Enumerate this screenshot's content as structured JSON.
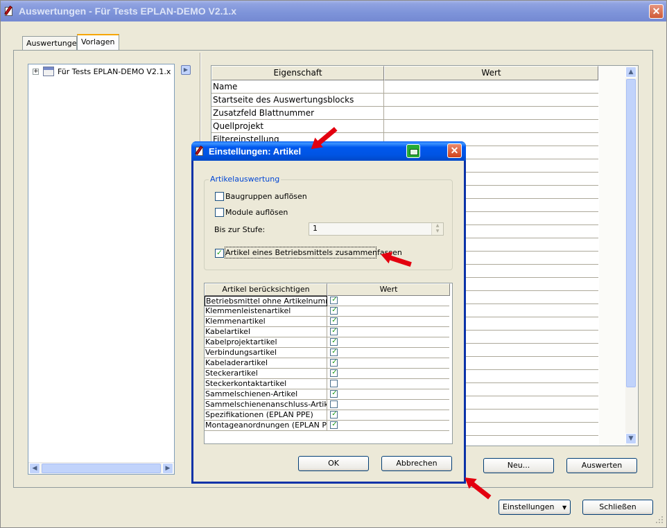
{
  "main_window": {
    "title": "Auswertungen - Für Tests EPLAN-DEMO V2.1.x",
    "close_glyph": "✕",
    "tabs": [
      {
        "label": "Auswertungen",
        "active": false
      },
      {
        "label": "Vorlagen",
        "active": true
      }
    ],
    "tree": {
      "root_label": "Für Tests EPLAN-DEMO V2.1.x",
      "expander_glyph": "+"
    },
    "properties": {
      "header_property": "Eigenschaft",
      "header_value": "Wert",
      "rows": [
        "Name",
        "Startseite des Auswertungsblocks",
        "Zusatzfeld Blattnummer",
        "Quellprojekt",
        "Filtereinstellung"
      ]
    },
    "buttons": {
      "neu": "Neu...",
      "auswerten": "Auswerten",
      "einstellungen": "Einstellungen",
      "schliessen": "Schließen"
    }
  },
  "dialog": {
    "title": "Einstellungen: Artikel",
    "close_glyph": "✕",
    "group_title": "Artikelauswertung",
    "options": {
      "baugruppen": {
        "label": "Baugruppen auflösen",
        "checked": false
      },
      "module": {
        "label": "Module auflösen",
        "checked": false
      },
      "stufe_label": "Bis zur Stufe:",
      "stufe_value": "1",
      "zusammenfassen": {
        "label": "Artikel eines Betriebsmittels zusammenfassen",
        "checked": true
      }
    },
    "table": {
      "header_label": "Artikel berücksichtigen",
      "header_value": "Wert",
      "rows": [
        {
          "label": "Betriebsmittel ohne Artikelnummer",
          "checked": true
        },
        {
          "label": "Klemmenleistenartikel",
          "checked": true
        },
        {
          "label": "Klemmenartikel",
          "checked": true
        },
        {
          "label": "Kabelartikel",
          "checked": true
        },
        {
          "label": "Kabelprojektartikel",
          "checked": true
        },
        {
          "label": "Verbindungsartikel",
          "checked": true
        },
        {
          "label": "Kabeladerartikel",
          "checked": true
        },
        {
          "label": "Steckerartikel",
          "checked": true
        },
        {
          "label": "Steckerkontaktartikel",
          "checked": false
        },
        {
          "label": "Sammelschienen-Artikel",
          "checked": true
        },
        {
          "label": "Sammelschienenanschluss-Artikel",
          "checked": false
        },
        {
          "label": "Spezifikationen (EPLAN PPE)",
          "checked": true
        },
        {
          "label": "Montageanordnungen (EPLAN PPE)",
          "checked": true
        }
      ]
    },
    "buttons": {
      "ok": "OK",
      "abbrechen": "Abbrechen"
    }
  },
  "colors": {
    "annotation_arrow": "#e3000f",
    "dialog_title_blue": "#0054e3",
    "check_green": "#21a121"
  }
}
